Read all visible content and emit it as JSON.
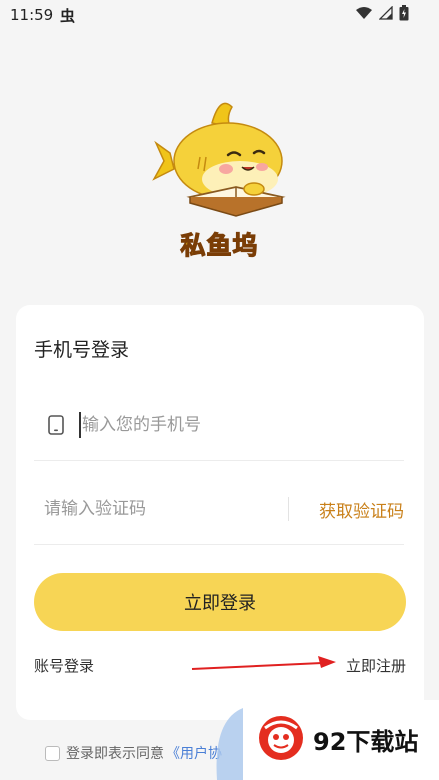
{
  "status_bar": {
    "time": "11:59",
    "notification_glyph": "虫",
    "icons": [
      "wifi-icon",
      "signal-icon",
      "battery-icon"
    ]
  },
  "app": {
    "name": "私鱼坞",
    "logo": "shark-reading-book-logo"
  },
  "login_card": {
    "title": "手机号登录",
    "phone_placeholder": "输入您的手机号",
    "code_placeholder": "请输入验证码",
    "get_code_label": "获取验证码",
    "login_button": "立即登录",
    "account_login": "账号登录",
    "register": "立即注册"
  },
  "agreement": {
    "prefix": "登录即表示同意",
    "link": "《用户协"
  },
  "watermark": {
    "text": "92下载站"
  },
  "colors": {
    "accent_yellow": "#f7d555",
    "get_code_orange": "#c9801a",
    "link_blue": "#4a7fd6",
    "app_name_yellow": "#f2c51c",
    "annotation_red": "#e02020"
  }
}
